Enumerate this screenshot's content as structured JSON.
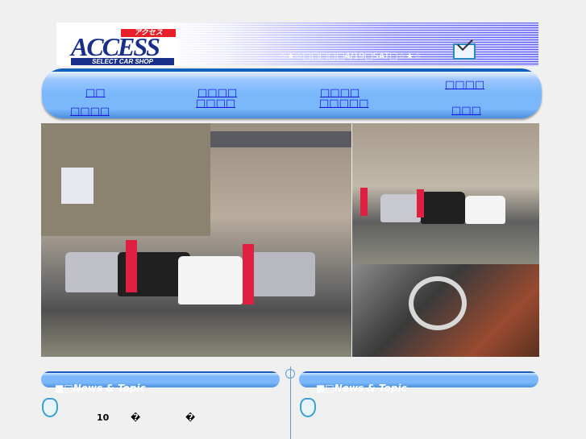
{
  "header": {
    "logo_katakana": "アクセス",
    "logo_word": "ACCESS",
    "logo_sub": "SELECT CAR SHOP",
    "date_text": "☆★☆□□□□□4/19□SAT□☆★☆",
    "mail_icon": "envelope-icon"
  },
  "nav": {
    "items": [
      {
        "label": "□□"
      },
      {
        "label": "□□□□"
      },
      {
        "label": "□□□□"
      },
      {
        "label": "□□□□"
      },
      {
        "label": "□□□□"
      },
      {
        "label": "□□□□□"
      },
      {
        "label": "□□□□"
      },
      {
        "label": "□□□"
      }
    ]
  },
  "news": [
    {
      "title": "■□News & Topic",
      "icon": "pointing-hand-icon",
      "items": [
        "10",
        "�",
        "�"
      ]
    },
    {
      "title": "■□News & Topic",
      "icon": "pointing-hand-icon",
      "items": []
    }
  ],
  "colors": {
    "nav_blue": "#7ab8fb",
    "link": "#1a1ae0",
    "banner": "#5a5af0"
  }
}
